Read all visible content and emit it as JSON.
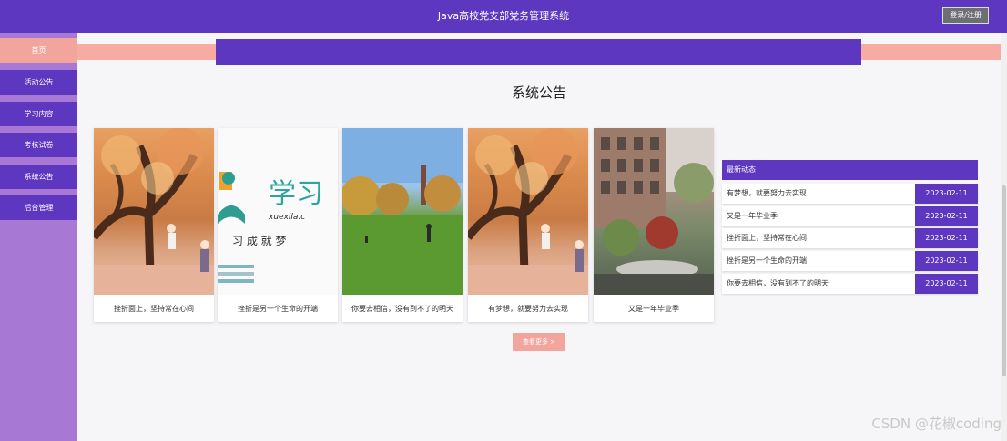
{
  "header": {
    "title": "Java高校党支部党务管理系统",
    "login_label": "登录/注册"
  },
  "sidebar": {
    "items": [
      {
        "label": "首页"
      },
      {
        "label": "活动公告"
      },
      {
        "label": "学习内容"
      },
      {
        "label": "考核试卷"
      },
      {
        "label": "系统公告"
      },
      {
        "label": "后台管理"
      }
    ]
  },
  "section": {
    "title": "系统公告"
  },
  "cards": [
    {
      "caption": "挫折面上，坚持常在心间",
      "image": "autumn-tree-girl"
    },
    {
      "caption": "挫折是另一个生命的开端",
      "image": "xuexila-logo",
      "logo_text": "学习",
      "logo_sub": "xuexila.c",
      "logo_slogan": "习 成 就 梦"
    },
    {
      "caption": "你要去相信，没有到不了的明天",
      "image": "campus-lawn"
    },
    {
      "caption": "有梦想，就要努力去实现",
      "image": "autumn-tree-girl"
    },
    {
      "caption": "又是一年毕业季",
      "image": "campus-building"
    }
  ],
  "more_label": "查看更多 >",
  "news": {
    "title": "最新动态",
    "items": [
      {
        "text": "有梦想，就要努力去实现",
        "date": "2023-02-11"
      },
      {
        "text": "又是一年毕业季",
        "date": "2023-02-11"
      },
      {
        "text": "挫折面上，坚持常在心间",
        "date": "2023-02-11"
      },
      {
        "text": "挫折是另一个生命的开端",
        "date": "2023-02-11"
      },
      {
        "text": "你要去相信，没有到不了的明天",
        "date": "2023-02-11"
      }
    ]
  },
  "watermark": "CSDN @花椒coding",
  "colors": {
    "primary": "#5d37bf",
    "accent": "#f2a59d",
    "sidebar_bg": "#a879d4"
  }
}
